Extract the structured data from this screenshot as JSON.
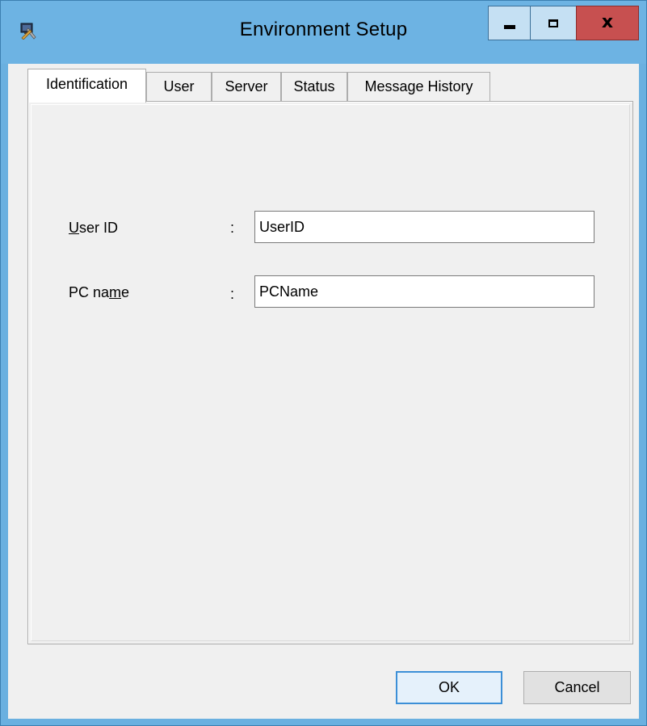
{
  "window": {
    "title": "Environment Setup",
    "icon": "settings-tools-icon",
    "controls": {
      "minimize": "minimize-icon",
      "maximize": "maximize-icon",
      "close": "x"
    }
  },
  "tabs": [
    {
      "label": "Identification",
      "active": true
    },
    {
      "label": "User",
      "active": false
    },
    {
      "label": "Server",
      "active": false
    },
    {
      "label": "Status",
      "active": false
    },
    {
      "label": "Message History",
      "active": false
    }
  ],
  "form": {
    "user_id": {
      "label": "User ID",
      "mnemonic": "U",
      "colon": ":",
      "value": "UserID"
    },
    "pc_name": {
      "label": "PC name",
      "mnemonic": "m",
      "colon": ":",
      "value": "PCName"
    }
  },
  "buttons": {
    "ok": "OK",
    "cancel": "Cancel"
  },
  "colors": {
    "titlebar": "#6db3e3",
    "close_button": "#c75050",
    "client": "#f0f0f0",
    "default_button_border": "#3c8fd7"
  }
}
